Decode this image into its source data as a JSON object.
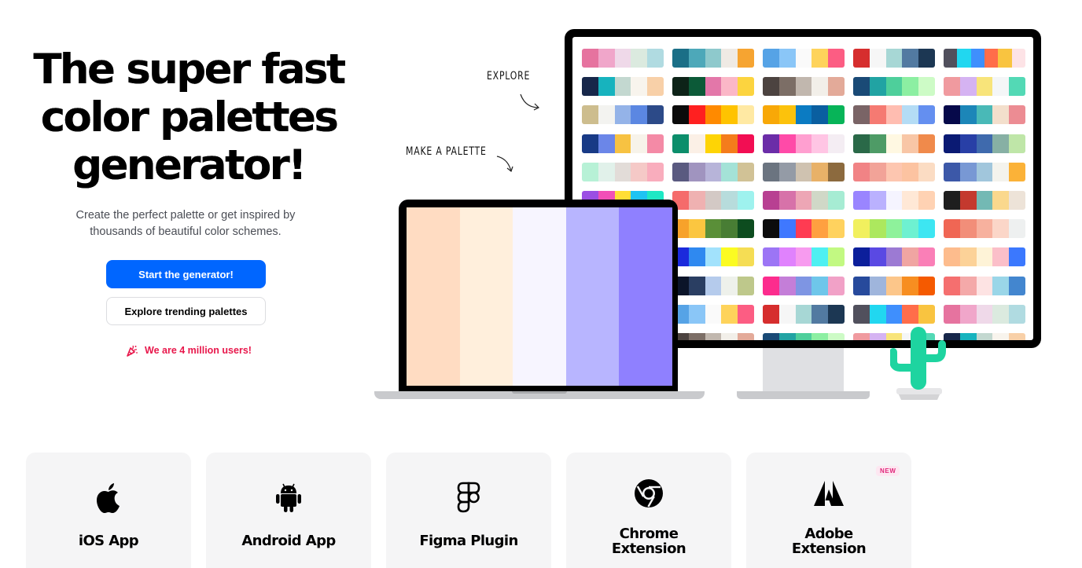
{
  "hero": {
    "title_line1": "The super fast",
    "title_line2": "color palettes",
    "title_line3": "generator!",
    "subtitle_line1": "Create the perfect palette or get inspired by",
    "subtitle_line2": "thousands of beautiful color schemes.",
    "primary_button": "Start the generator!",
    "secondary_button": "Explore trending palettes",
    "users_text": "We are 4 million users!",
    "accent_color": "#0066ff",
    "users_color": "#e8174b"
  },
  "illustration": {
    "explore_label": "EXPLORE",
    "make_label": "MAKE A PALETTE",
    "laptop_palette": [
      "#ffdcc2",
      "#ffefdc",
      "#f7f5ff",
      "#b8b5ff",
      "#8f80ff"
    ],
    "monitor_palettes": [
      [
        [
          "#e6739f",
          "#f0a6ca",
          "#efd9e9",
          "#dbeadf",
          "#b0dbe1"
        ],
        [
          "#1b6f87",
          "#4da8b9",
          "#8ec9cc",
          "#efeae4",
          "#f6a431"
        ],
        [
          "#56a3e6",
          "#8ac6f7",
          "#fafafa",
          "#fed35b",
          "#fc5d83"
        ],
        [
          "#d62e2e",
          "#f6f6f6",
          "#a7d7d5",
          "#527aa1",
          "#1c3753"
        ],
        [
          "#51505d",
          "#21d7f0",
          "#3f8ffd",
          "#ff6d4a",
          "#f9c440",
          "#fde3e6"
        ]
      ],
      [
        [
          "#17274a",
          "#17b3be",
          "#c3d8d0",
          "#f8f4ed",
          "#f8d0a8"
        ],
        [
          "#0d2318",
          "#0c5a38",
          "#e377a9",
          "#fbb7c7",
          "#fcd43f"
        ],
        [
          "#4c4340",
          "#7c6e66",
          "#c1b7ae",
          "#f2efe9",
          "#e3aa99"
        ],
        [
          "#1a4a76",
          "#21a3a3",
          "#4ecf9b",
          "#8cefa2",
          "#cdfbc6"
        ],
        [
          "#f09a9f",
          "#d5b3f2",
          "#f8e47a",
          "#f4f6f7",
          "#53d9b5"
        ]
      ],
      [
        [
          "#cdbd8e",
          "#f3f3f0",
          "#94b3e8",
          "#5b87e2",
          "#2c4a88"
        ],
        [
          "#0b0b0b",
          "#ff2020",
          "#ff8a00",
          "#ffc300",
          "#ffe9a3"
        ],
        [
          "#f8a807",
          "#fcc20c",
          "#0b7bc2",
          "#0a5fa0",
          "#07b458"
        ],
        [
          "#7a6466",
          "#f57a72",
          "#ffbdb1",
          "#b4dcf5",
          "#648ff0"
        ],
        [
          "#06094a",
          "#1c86b8",
          "#49b9b7",
          "#f3dfcc",
          "#ec8c93"
        ]
      ],
      [
        [
          "#183a86",
          "#6b86e8",
          "#f7c242",
          "#f7f3ea",
          "#f48aa6"
        ],
        [
          "#0c8e6b",
          "#fbf0e6",
          "#fed405",
          "#f47c1c",
          "#f20e53"
        ],
        [
          "#6b2da8",
          "#ff4aa8",
          "#ff9fd0",
          "#ffc5e4",
          "#f4edf3"
        ],
        [
          "#2a6948",
          "#4e9b66",
          "#fff8e2",
          "#f8c6a6",
          "#f08a4b"
        ],
        [
          "#0a1a73",
          "#283fa6",
          "#3f6aad",
          "#87b0a4",
          "#bfe6a8"
        ]
      ],
      [
        [
          "#b7f1d6",
          "#e1f1ea",
          "#e2dcd8",
          "#f5c9c7",
          "#f9adbd"
        ],
        [
          "#5a5a80",
          "#a094bf",
          "#b7b4d9",
          "#a4e2d7",
          "#d1c296"
        ],
        [
          "#6b7480",
          "#949ba6",
          "#cfc2b0",
          "#e8b168",
          "#8c6a3e"
        ],
        [
          "#f18385",
          "#f2a398",
          "#fdc6b0",
          "#fcc3a1",
          "#fbdcc3"
        ],
        [
          "#3c58a8",
          "#7898d4",
          "#a1c6dc",
          "#f4f3ed",
          "#fbb238"
        ]
      ],
      [
        [
          "#9b4fe3",
          "#f14fb7",
          "#ffde35",
          "#1ec3f2",
          "#1ee8c4"
        ],
        [
          "#f56b6b",
          "#efb1b1",
          "#d3c9c5",
          "#b7dcdc",
          "#9ef2ee"
        ],
        [
          "#b84092",
          "#d772a9",
          "#eda6b5",
          "#d0d8c7",
          "#a6ecd3"
        ],
        [
          "#9a85ff",
          "#bab1fe",
          "#f5f4ff",
          "#ffe8d6",
          "#ffd2b3"
        ],
        [
          "#1e1e1e",
          "#c4392e",
          "#73b9b4",
          "#fad88d",
          "#ede3d8"
        ]
      ],
      [
        [
          "#2c1c4e",
          "#57327c",
          "#b37ab6",
          "#fd9d8b",
          "#fed7a1"
        ],
        [
          "#f7a22a",
          "#fbc640",
          "#5a8f38",
          "#487d34",
          "#0d4c1f"
        ],
        [
          "#0c0c0c",
          "#3f78ff",
          "#ff3b52",
          "#ffa040",
          "#ffd25e"
        ],
        [
          "#f1f05e",
          "#ace85e",
          "#8ef29b",
          "#6ef1d1",
          "#3de6f2"
        ],
        [
          "#f06654",
          "#f28e79",
          "#f7b19e",
          "#fbd6c8",
          "#eef0f0"
        ]
      ],
      [
        [
          "#1a56f7",
          "#3fa3f7",
          "#9ccbf7",
          "#fef60e",
          "#f9f3a8"
        ],
        [
          "#1b2adc",
          "#2f89f0",
          "#a2e2fc",
          "#fbfb22",
          "#f5dd54"
        ],
        [
          "#9c75f5",
          "#e082fd",
          "#f79bef",
          "#4ef0f2",
          "#c2f982"
        ],
        [
          "#0c1f9b",
          "#5a49e3",
          "#9c7ad3",
          "#f0a5a2",
          "#fa7fb7"
        ],
        [
          "#fdbc8d",
          "#fcd298",
          "#fef3d7",
          "#fbbfc9",
          "#3b78fe"
        ]
      ],
      [
        [
          "#6b4c3c",
          "#c09a7e",
          "#f8d4a7",
          "#f4f1ec",
          "#b7a5e2"
        ],
        [
          "#0b1429",
          "#2a3e62",
          "#b5cbec",
          "#eef1eb",
          "#bec88b"
        ],
        [
          "#fc2c8d",
          "#c47ed8",
          "#7e95e3",
          "#6ec6ea",
          "#f1a1c7"
        ],
        [
          "#274a9c",
          "#9fb5dc",
          "#fcc68a",
          "#f78e21",
          "#f55a00"
        ],
        [
          "#f56f6f",
          "#f4a9a9",
          "#fde3e3",
          "#9ad6e8",
          "#4386cf"
        ]
      ],
      [
        [
          "#1b6f87",
          "#4da8b9",
          "#8ec9cc",
          "#efeae4",
          "#f6a431"
        ],
        [
          "#56a3e6",
          "#8ac6f7",
          "#fafafa",
          "#fed35b",
          "#fc5d83"
        ],
        [
          "#d62e2e",
          "#f6f6f6",
          "#a7d7d5",
          "#527aa1",
          "#1c3753"
        ],
        [
          "#51505d",
          "#21d7f0",
          "#3f8ffd",
          "#ff6d4a",
          "#f9c440"
        ],
        [
          "#e6739f",
          "#f0a6ca",
          "#efd9e9",
          "#dbeadf",
          "#b0dbe1"
        ]
      ],
      [
        [
          "#0d2318",
          "#0c5a38",
          "#e377a9",
          "#fbb7c7",
          "#fcd43f"
        ],
        [
          "#4c4340",
          "#7c6e66",
          "#c1b7ae",
          "#f2efe9",
          "#e3aa99"
        ],
        [
          "#1a4a76",
          "#21a3a3",
          "#4ecf9b",
          "#8cefa2",
          "#cdfbc6"
        ],
        [
          "#f09a9f",
          "#d5b3f2",
          "#f8e47a",
          "#f4f6f7",
          "#53d9b5"
        ],
        [
          "#17274a",
          "#17b3be",
          "#c3d8d0",
          "#f8f4ed",
          "#f8d0a8"
        ]
      ]
    ]
  },
  "cards": [
    {
      "label_line1": "iOS App",
      "label_line2": "",
      "icon": "apple-icon"
    },
    {
      "label_line1": "Android App",
      "label_line2": "",
      "icon": "android-icon"
    },
    {
      "label_line1": "Figma Plugin",
      "label_line2": "",
      "icon": "figma-icon"
    },
    {
      "label_line1": "Chrome",
      "label_line2": "Extension",
      "icon": "chrome-icon"
    },
    {
      "label_line1": "Adobe",
      "label_line2": "Extension",
      "icon": "adobe-icon",
      "badge": "NEW"
    }
  ]
}
